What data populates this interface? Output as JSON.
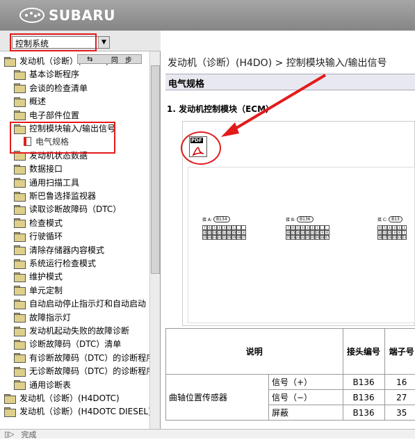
{
  "brand": "SUBARU",
  "selector": {
    "value": "控制系统"
  },
  "sync_label": "同　步",
  "tree": [
    {
      "label": "发动机（诊断）(H4DO)",
      "level": 0,
      "type": "folder-open"
    },
    {
      "label": "基本诊断程序",
      "level": 1,
      "type": "folder"
    },
    {
      "label": "会谈的检查清单",
      "level": 1,
      "type": "folder"
    },
    {
      "label": "概述",
      "level": 1,
      "type": "folder"
    },
    {
      "label": "电子部件位置",
      "level": 1,
      "type": "folder"
    },
    {
      "label": "控制模块输入/输出信号",
      "level": 1,
      "type": "folder-open"
    },
    {
      "label": "电气规格",
      "level": 2,
      "type": "doc",
      "selected": true
    },
    {
      "label": "发动机状态数据",
      "level": 1,
      "type": "folder"
    },
    {
      "label": "数据接口",
      "level": 1,
      "type": "folder"
    },
    {
      "label": "通用扫描工具",
      "level": 1,
      "type": "folder"
    },
    {
      "label": "斯巴鲁选择监视器",
      "level": 1,
      "type": "folder"
    },
    {
      "label": "读取诊断故障码（DTC）",
      "level": 1,
      "type": "folder"
    },
    {
      "label": "检查模式",
      "level": 1,
      "type": "folder"
    },
    {
      "label": "行驶循环",
      "level": 1,
      "type": "folder"
    },
    {
      "label": "清除存储器内容模式",
      "level": 1,
      "type": "folder"
    },
    {
      "label": "系统运行检查模式",
      "level": 1,
      "type": "folder"
    },
    {
      "label": "维护模式",
      "level": 1,
      "type": "folder"
    },
    {
      "label": "单元定制",
      "level": 1,
      "type": "folder"
    },
    {
      "label": "自动启动停止指示灯和自动启动",
      "level": 1,
      "type": "folder"
    },
    {
      "label": "故障指示灯",
      "level": 1,
      "type": "folder"
    },
    {
      "label": "发动机起动失败的故障诊断",
      "level": 1,
      "type": "folder"
    },
    {
      "label": "诊断故障码（DTC）清单",
      "level": 1,
      "type": "folder"
    },
    {
      "label": "有诊断故障码（DTC）的诊断程序",
      "level": 1,
      "type": "folder"
    },
    {
      "label": "无诊断故障码（DTC）的诊断程序",
      "level": 1,
      "type": "folder"
    },
    {
      "label": "通用诊断表",
      "level": 1,
      "type": "folder"
    },
    {
      "label": "发动机（诊断）(H4DOTC)",
      "level": 0,
      "type": "folder"
    },
    {
      "label": "发动机（诊断）(H4DOTC DIESEL)",
      "level": 0,
      "type": "folder"
    }
  ],
  "main": {
    "breadcrumb": "发动机（诊断）(H4DO) > 控制模块输入/输出信号",
    "section_title": "电气规格",
    "subtitle": "1. 发动机控制模块（ECM）",
    "pdf_label": "PDF",
    "connectors": [
      {
        "label": "B134"
      },
      {
        "label": "B136"
      },
      {
        "label": "B13"
      }
    ],
    "table": {
      "headers": [
        "说明",
        "接头编号",
        "端子号"
      ],
      "rows": [
        {
          "desc": "曲轴位置传感器",
          "sub": "信号（+）",
          "conn": "B136",
          "term": "16"
        },
        {
          "desc": "",
          "sub": "信号（−）",
          "conn": "B136",
          "term": "27"
        },
        {
          "desc": "",
          "sub": "屏蔽",
          "conn": "B136",
          "term": "35"
        }
      ]
    }
  },
  "status": {
    "text": "完成"
  }
}
